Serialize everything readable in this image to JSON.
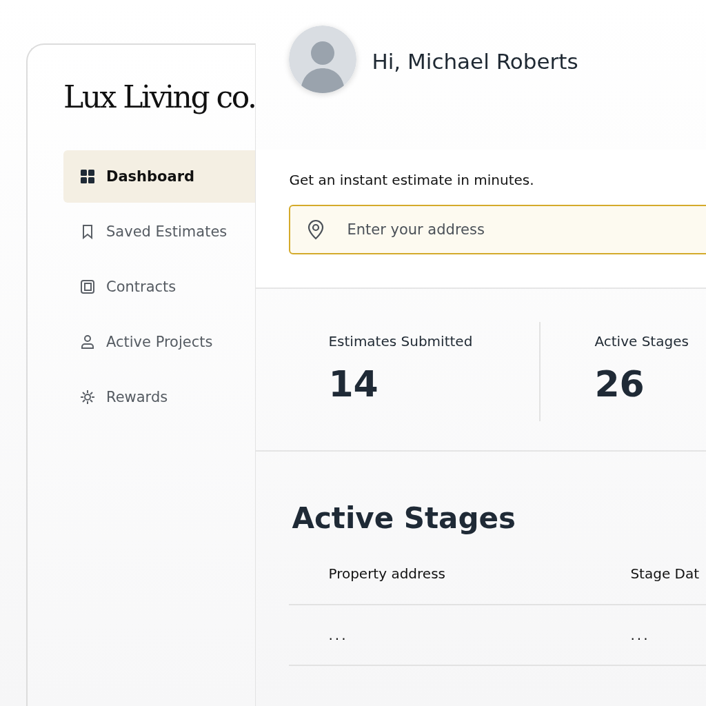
{
  "sidebar": {
    "logo": "Lux Living co.",
    "items": [
      {
        "label": "Dashboard",
        "selected": true
      },
      {
        "label": "Saved Estimates",
        "selected": false
      },
      {
        "label": "Contracts",
        "selected": false
      },
      {
        "label": "Active Projects",
        "selected": false
      },
      {
        "label": "Rewards",
        "selected": false
      }
    ]
  },
  "header": {
    "greeting": "Hi, Michael Roberts"
  },
  "estimate": {
    "prompt": "Get an instant estimate in minutes.",
    "address_field": {
      "placeholder": "Enter your address"
    }
  },
  "stats": [
    {
      "label": "Estimates Submitted",
      "value": "14"
    },
    {
      "label": "Active Stages",
      "value": "26"
    }
  ],
  "active_stages": {
    "title": "Active Stages",
    "table": {
      "columns": [
        "Property address",
        "Stage Dat"
      ],
      "rows": [
        [
          "...",
          "..."
        ]
      ]
    }
  }
}
